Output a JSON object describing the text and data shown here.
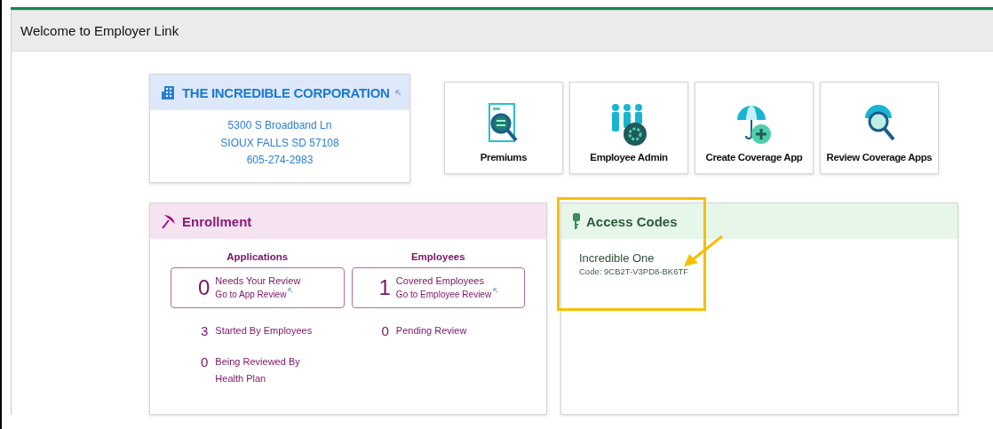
{
  "window": {
    "title": "Welcome to Employer Link"
  },
  "company": {
    "name": "THE INCREDIBLE CORPORATION",
    "address_lines": [
      "5300 S Broadband Ln",
      "SIOUX FALLS SD 57108",
      "605-274-2983"
    ]
  },
  "tiles": [
    {
      "kind": "premiums",
      "label": "Premiums"
    },
    {
      "kind": "admin",
      "label": "Employee Admin"
    },
    {
      "kind": "create",
      "label": "Create Coverage App"
    },
    {
      "kind": "review",
      "label": "Review Coverage Apps"
    }
  ],
  "enrollment": {
    "title": "Enrollment",
    "columns": [
      {
        "heading": "Applications",
        "featured": {
          "count": "0",
          "label": "Needs Your Review",
          "link": "Go to App Review"
        },
        "items": [
          {
            "count": "3",
            "label": "Started By Employees"
          },
          {
            "count": "0",
            "label": "Being Reviewed By Health Plan"
          }
        ]
      },
      {
        "heading": "Employees",
        "featured": {
          "count": "1",
          "label": "Covered Employees",
          "link": "Go to Employee Review"
        },
        "items": [
          {
            "count": "0",
            "label": "Pending Review"
          }
        ]
      }
    ]
  },
  "access_codes": {
    "title": "Access Codes",
    "entries": [
      {
        "name": "Incredible One",
        "code": "Code: 9CB2T-V3PD8-BK6TF"
      }
    ],
    "highlighted": true
  }
}
